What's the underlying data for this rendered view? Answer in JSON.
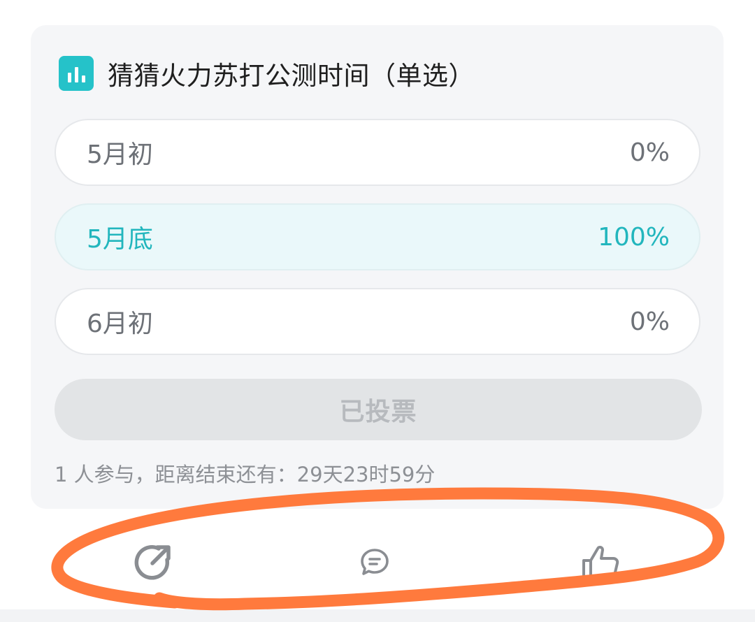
{
  "poll": {
    "icon": "bar-chart-icon",
    "title": "猜猜火力苏打公测时间（单选）",
    "options": [
      {
        "label": "5月初",
        "percent": "0%",
        "selected": false
      },
      {
        "label": "5月底",
        "percent": "100%",
        "selected": true
      },
      {
        "label": "6月初",
        "percent": "0%",
        "selected": false
      }
    ],
    "vote_button_label": "已投票",
    "meta": "1 人参与，距离结束还有：29天23时59分"
  },
  "actions": [
    {
      "icon": "share-icon"
    },
    {
      "icon": "comment-icon"
    },
    {
      "icon": "thumbs-up-icon"
    }
  ],
  "colors": {
    "accent": "#25c2c9",
    "annotation": "#ff7a3d"
  }
}
